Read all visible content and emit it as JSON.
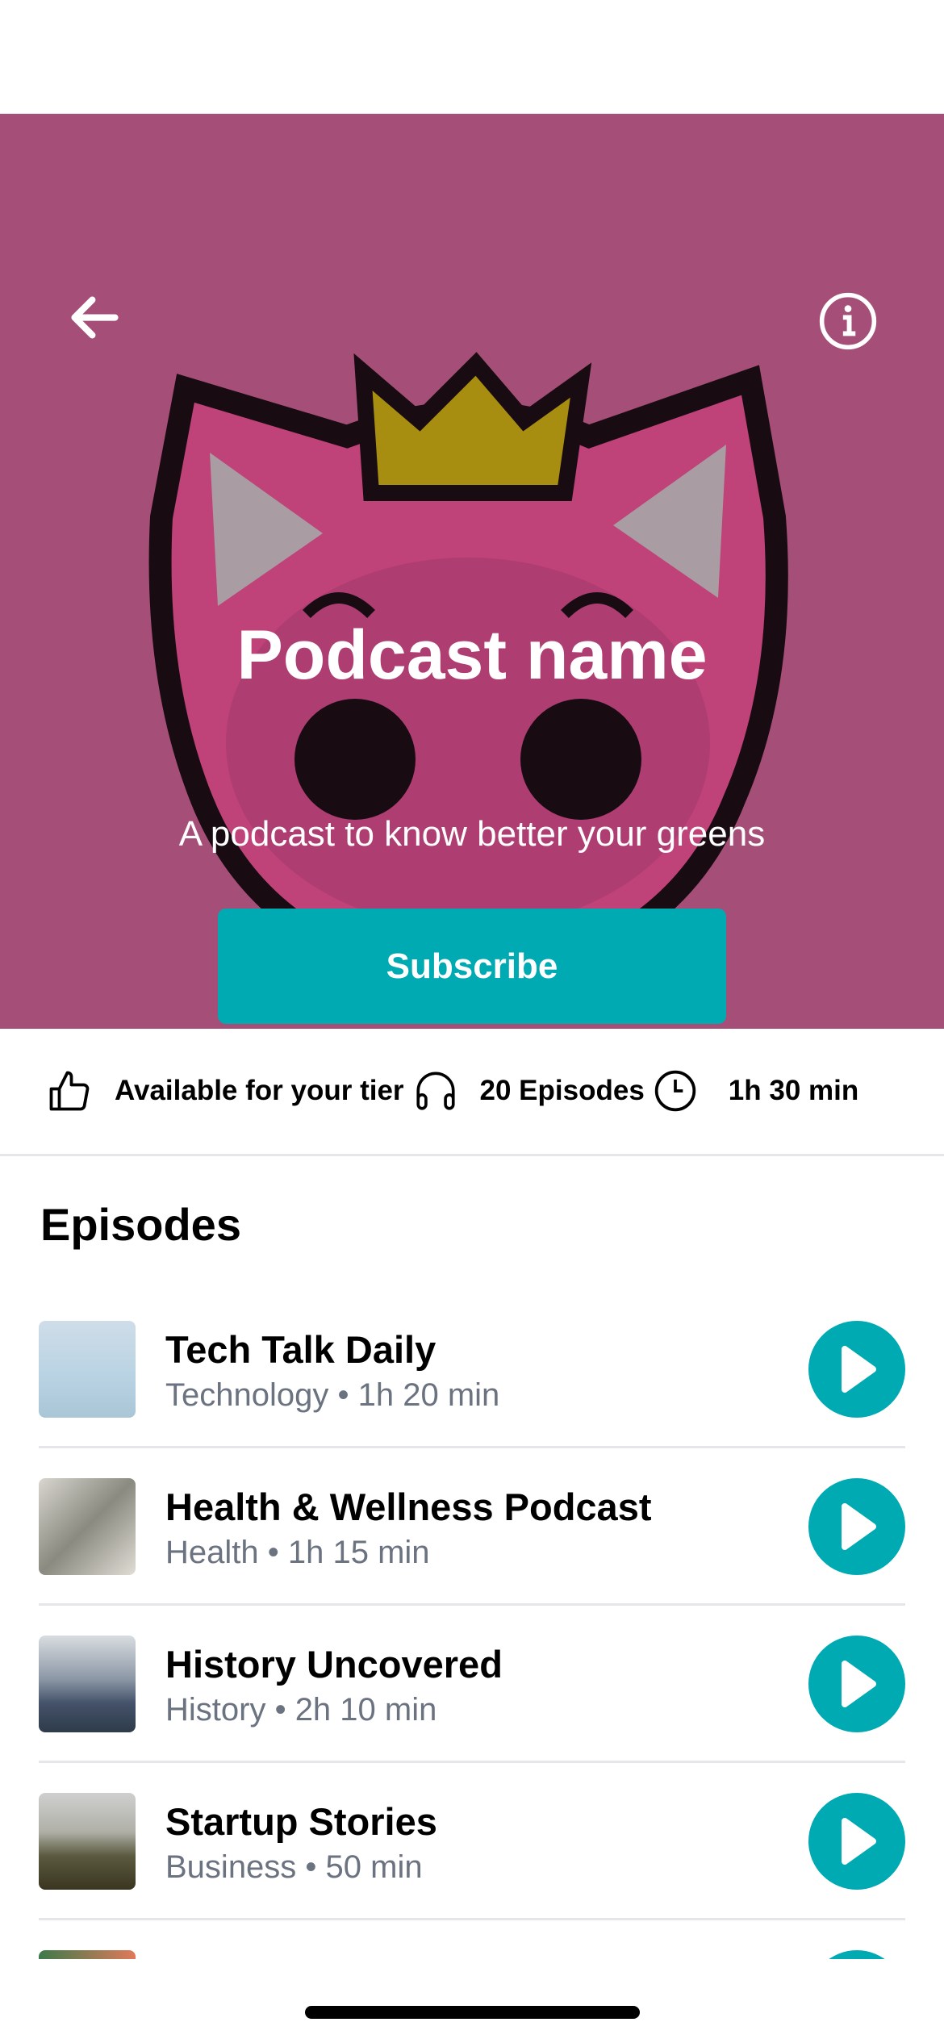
{
  "header": {
    "back_icon": "arrow-left-icon",
    "info_icon": "info-circle-icon"
  },
  "hero": {
    "title": "Podcast name",
    "subtitle": "A podcast to know better your greens",
    "subscribe_label": "Subscribe",
    "background": "#a54f78"
  },
  "stats": [
    {
      "icon": "thumbs-up-icon",
      "label": "Available for your tier"
    },
    {
      "icon": "headphones-icon",
      "label": "20 Episodes"
    },
    {
      "icon": "clock-icon",
      "label": "1h 30 min"
    }
  ],
  "episodes_heading": "Episodes",
  "episodes": [
    {
      "title": "Tech Talk Daily",
      "category": "Technology",
      "duration": "1h 20 min",
      "sep": " • "
    },
    {
      "title": "Health & Wellness Podcast",
      "category": "Health",
      "duration": "1h 15 min",
      "sep": " • "
    },
    {
      "title": "History Uncovered",
      "category": "History",
      "duration": "2h 10 min",
      "sep": " • "
    },
    {
      "title": "Startup Stories",
      "category": "Business",
      "duration": "50 min",
      "sep": " • "
    }
  ],
  "colors": {
    "accent": "#00aab3",
    "muted": "#6b7280"
  }
}
